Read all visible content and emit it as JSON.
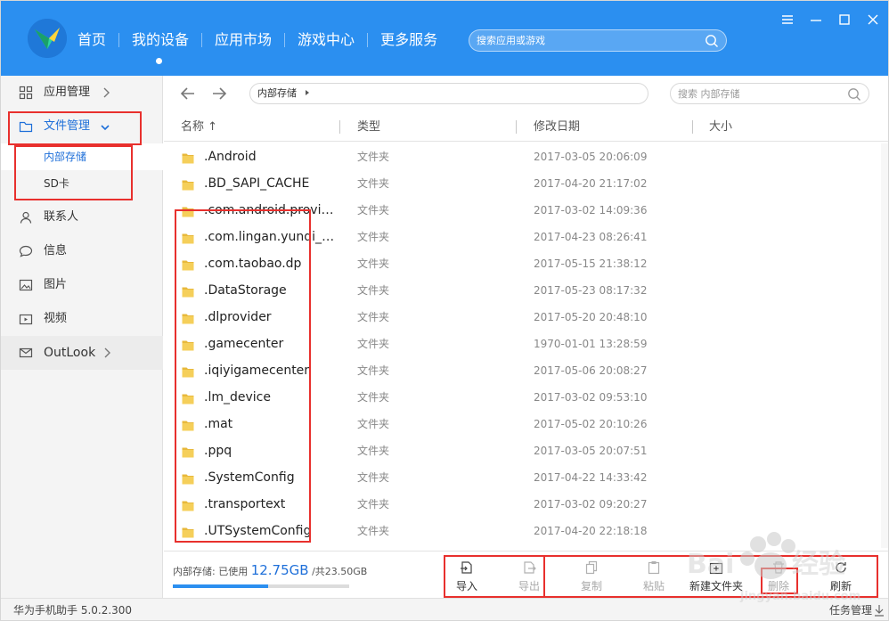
{
  "header": {
    "nav": [
      "首页",
      "我的设备",
      "应用市场",
      "游戏中心",
      "更多服务"
    ],
    "active_nav": "我的设备",
    "search_placeholder": "搜索应用或游戏"
  },
  "sidebar": {
    "items": [
      {
        "label": "应用管理",
        "icon": "grid-icon"
      },
      {
        "label": "文件管理",
        "icon": "folder-icon"
      },
      {
        "label": "联系人",
        "icon": "contact-icon"
      },
      {
        "label": "信息",
        "icon": "chat-icon"
      },
      {
        "label": "图片",
        "icon": "image-icon"
      },
      {
        "label": "视频",
        "icon": "video-icon"
      },
      {
        "label": "OutLook",
        "icon": "mail-icon"
      }
    ],
    "sub_items": [
      "内部存储",
      "SD卡"
    ],
    "active_sub": "内部存储"
  },
  "toolbar": {
    "path": "内部存储",
    "search_placeholder": "搜索 内部存储"
  },
  "table": {
    "columns": [
      "名称 ↑",
      "类型",
      "修改日期",
      "大小"
    ],
    "rows": [
      {
        "name": ".Android",
        "type": "文件夹",
        "date": "2017-03-05 20:06:09"
      },
      {
        "name": ".BD_SAPI_CACHE",
        "type": "文件夹",
        "date": "2017-04-20 21:17:02"
      },
      {
        "name": ".com.android.provid...",
        "type": "文件夹",
        "date": "2017-03-02 14:09:36"
      },
      {
        "name": ".com.lingan.yunqi_bi...",
        "type": "文件夹",
        "date": "2017-04-23 08:26:41"
      },
      {
        "name": ".com.taobao.dp",
        "type": "文件夹",
        "date": "2017-05-15 21:38:12"
      },
      {
        "name": ".DataStorage",
        "type": "文件夹",
        "date": "2017-05-23 08:17:32"
      },
      {
        "name": ".dlprovider",
        "type": "文件夹",
        "date": "2017-05-20 20:48:10"
      },
      {
        "name": ".gamecenter",
        "type": "文件夹",
        "date": "1970-01-01 13:28:59"
      },
      {
        "name": ".iqiyigamecenter",
        "type": "文件夹",
        "date": "2017-05-06 20:08:27"
      },
      {
        "name": ".lm_device",
        "type": "文件夹",
        "date": "2017-03-02 09:53:10"
      },
      {
        "name": ".mat",
        "type": "文件夹",
        "date": "2017-05-02 20:10:26"
      },
      {
        "name": ".ppq",
        "type": "文件夹",
        "date": "2017-03-05 20:07:51"
      },
      {
        "name": ".SystemConfig",
        "type": "文件夹",
        "date": "2017-04-22 14:33:42"
      },
      {
        "name": ".transportext",
        "type": "文件夹",
        "date": "2017-03-02 09:20:27"
      },
      {
        "name": ".UTSystemConfig",
        "type": "文件夹",
        "date": "2017-04-20 22:18:18"
      }
    ]
  },
  "storage": {
    "label": "内部存储: 已使用",
    "used": "12.75GB",
    "total": "/共23.50GB",
    "used_fraction": 0.5426
  },
  "actions": [
    {
      "label": "导入",
      "enabled": true,
      "icon": "import-icon"
    },
    {
      "label": "导出",
      "enabled": false,
      "icon": "export-icon"
    },
    {
      "label": "复制",
      "enabled": false,
      "icon": "copy-icon"
    },
    {
      "label": "粘贴",
      "enabled": false,
      "icon": "paste-icon"
    },
    {
      "label": "新建文件夹",
      "enabled": true,
      "icon": "new-folder-icon"
    },
    {
      "label": "删除",
      "enabled": false,
      "icon": "delete-icon"
    },
    {
      "label": "刷新",
      "enabled": true,
      "icon": "refresh-icon"
    }
  ],
  "statusbar": {
    "version": "华为手机助手 5.0.2.300",
    "task_manager": "任务管理"
  },
  "colors": {
    "header_blue": "#2b8ff0",
    "accent": "#1e6fd9",
    "highlight_red": "#e8302d"
  }
}
